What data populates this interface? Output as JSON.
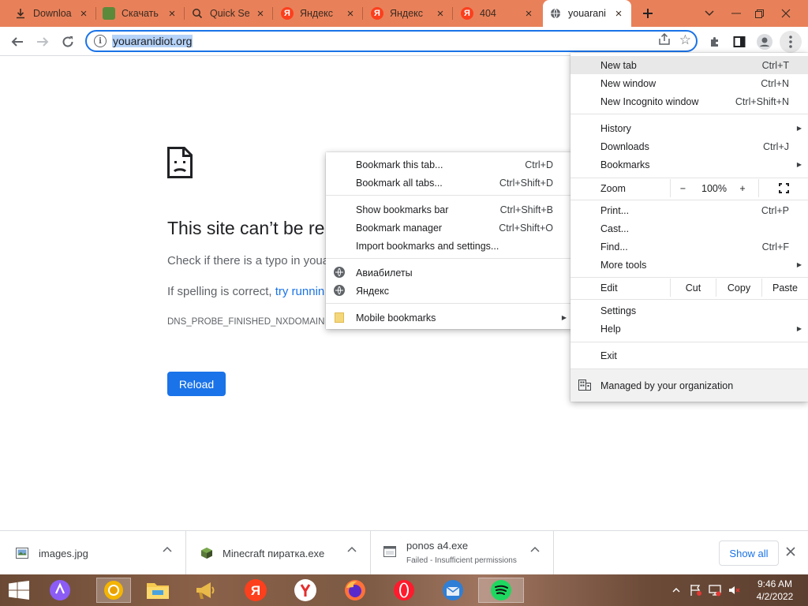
{
  "tabs": [
    {
      "title": "Downloa",
      "icon": "download-icon"
    },
    {
      "title": "Скачать",
      "icon": "site-favicon"
    },
    {
      "title": "Quick Se",
      "icon": "search-icon"
    },
    {
      "title": "Яндекс",
      "icon": "yandex-favicon",
      "glyph": "Я"
    },
    {
      "title": "Яндекс",
      "icon": "yandex-favicon",
      "glyph": "Я"
    },
    {
      "title": "404",
      "icon": "yandex-favicon",
      "glyph": "Я"
    },
    {
      "title": "youarani",
      "icon": "globe-icon",
      "active": true
    }
  ],
  "omnibox": {
    "url": "youaranidiot.org"
  },
  "error_page": {
    "title": "This site can’t be re",
    "line1": "Check if there is a typo in youa",
    "line2_prefix": "If spelling is correct, ",
    "line2_link": "try runnin",
    "code": "DNS_PROBE_FINISHED_NXDOMAIN",
    "reload": "Reload"
  },
  "bookmarks_menu": {
    "items": [
      {
        "label": "Bookmark this tab...",
        "shortcut": "Ctrl+D"
      },
      {
        "label": "Bookmark all tabs...",
        "shortcut": "Ctrl+Shift+D"
      },
      {
        "label": "Show bookmarks bar",
        "shortcut": "Ctrl+Shift+B"
      },
      {
        "label": "Bookmark manager",
        "shortcut": "Ctrl+Shift+O"
      },
      {
        "label": "Import bookmarks and settings...",
        "shortcut": ""
      },
      {
        "label": "Авиабилеты",
        "shortcut": ""
      },
      {
        "label": "Яндекс",
        "shortcut": ""
      },
      {
        "label": "Mobile bookmarks",
        "shortcut": ""
      }
    ]
  },
  "main_menu": {
    "new_tab": {
      "label": "New tab",
      "shortcut": "Ctrl+T"
    },
    "new_window": {
      "label": "New window",
      "shortcut": "Ctrl+N"
    },
    "new_incognito": {
      "label": "New Incognito window",
      "shortcut": "Ctrl+Shift+N"
    },
    "history": "History",
    "downloads": {
      "label": "Downloads",
      "shortcut": "Ctrl+J"
    },
    "bookmarks": "Bookmarks",
    "zoom": {
      "label": "Zoom",
      "minus": "−",
      "value": "100%",
      "plus": "+"
    },
    "print": {
      "label": "Print...",
      "shortcut": "Ctrl+P"
    },
    "cast": "Cast...",
    "find": {
      "label": "Find...",
      "shortcut": "Ctrl+F"
    },
    "more_tools": "More tools",
    "edit": {
      "label": "Edit",
      "cut": "Cut",
      "copy": "Copy",
      "paste": "Paste"
    },
    "settings": "Settings",
    "help": "Help",
    "exit": "Exit",
    "managed": "Managed by your organization"
  },
  "downloads": [
    {
      "name": "images.jpg",
      "status": ""
    },
    {
      "name": "Minecraft пиратка.exe",
      "status": ""
    },
    {
      "name": "ponos a4.exe",
      "status": "Failed - Insufficient permissions"
    }
  ],
  "downloads_show_all": "Show all",
  "taskbar": {
    "time": "9:46 AM",
    "date": "4/2/2022"
  },
  "colors": {
    "tabstrip": "#e8815a",
    "accent": "#1a73e8"
  }
}
